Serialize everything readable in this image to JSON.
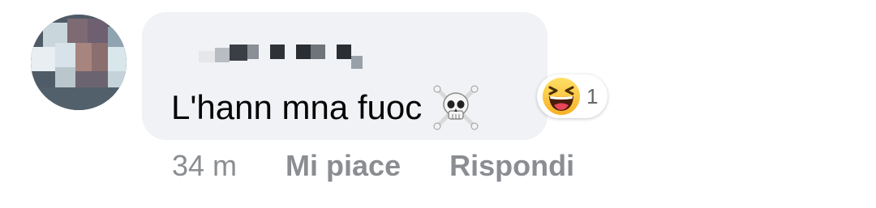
{
  "comment": {
    "text": "L'hann mna fuoc",
    "text_emoji": "skull-and-crossbones-icon",
    "author_name_hidden": true,
    "avatar_blurred": true
  },
  "reaction": {
    "emoji": "laughing-face-icon",
    "count": "1"
  },
  "actions": {
    "time": "34 m",
    "like_label": "Mi piace",
    "reply_label": "Rispondi"
  },
  "colors": {
    "bubble": "#f0f2f5",
    "text": "#050505",
    "meta": "#8a8d91"
  }
}
